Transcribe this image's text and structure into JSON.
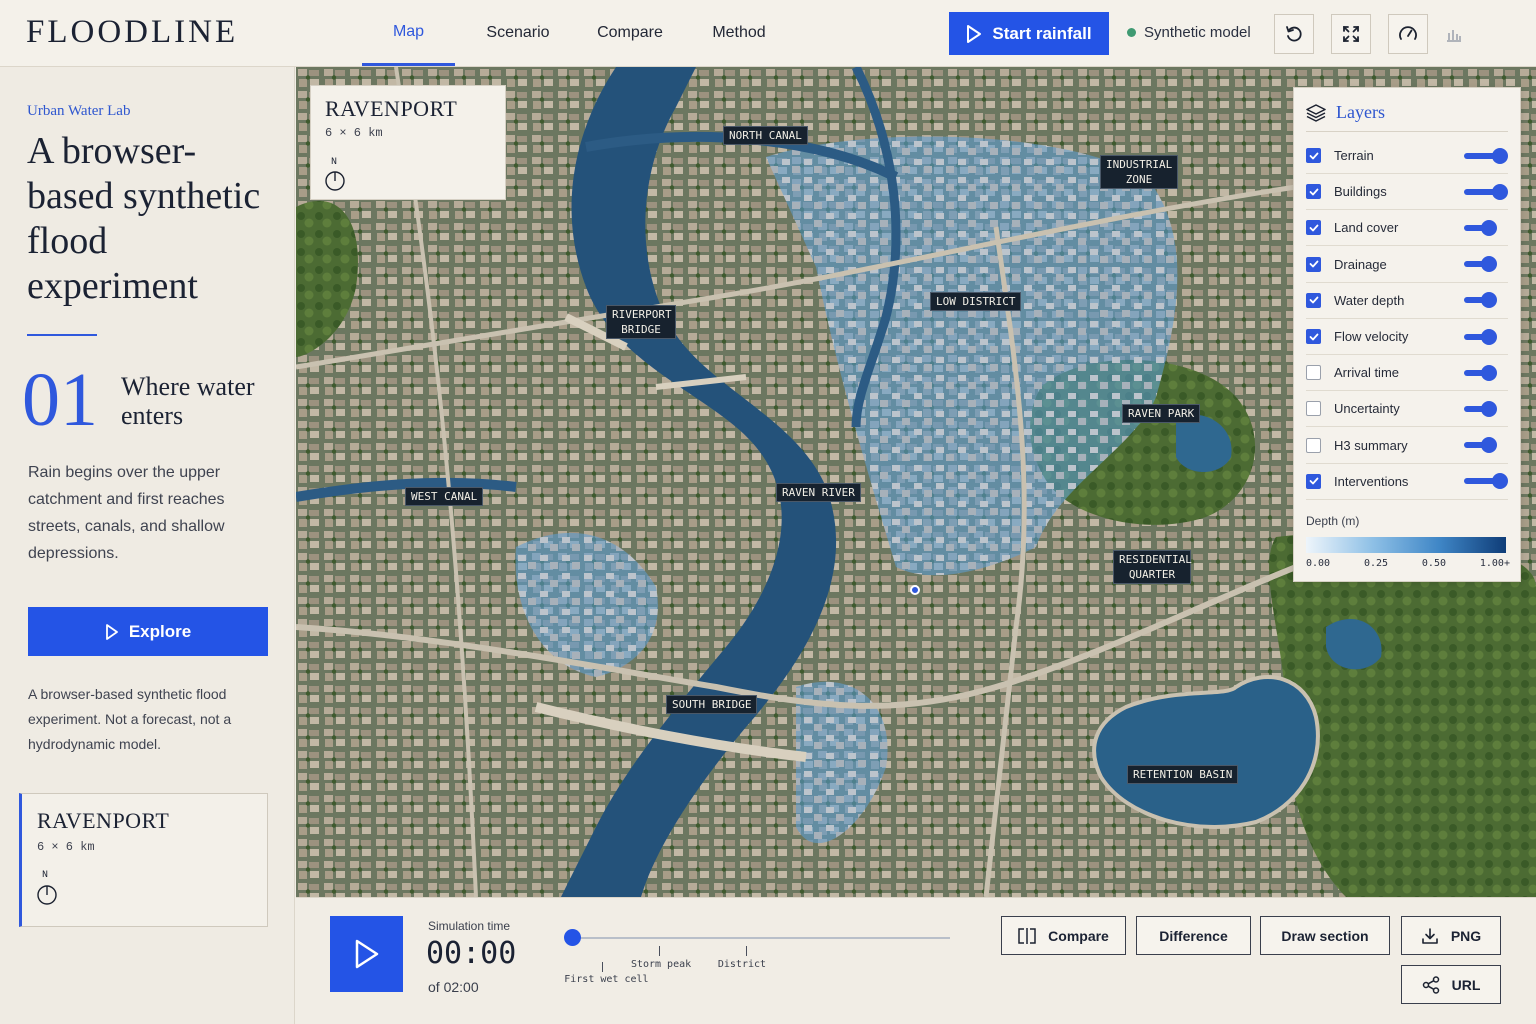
{
  "app": {
    "title": "FLOODLINE"
  },
  "nav": {
    "tabs": [
      {
        "label": "Map",
        "active": true
      },
      {
        "label": "Scenario",
        "active": false
      },
      {
        "label": "Compare",
        "active": false
      },
      {
        "label": "Method",
        "active": false
      }
    ]
  },
  "header": {
    "start_label": "Start rainfall",
    "status_text": "Synthetic model",
    "status_color": "#3f9a72",
    "icons": [
      "reset-icon",
      "fullscreen-icon",
      "gauge-icon",
      "bar-chart-icon"
    ]
  },
  "sidebar": {
    "kicker": "Urban Water Lab",
    "title": "A browser-based synthetic flood experiment",
    "step_number": "01",
    "step_title": "Where water enters",
    "step_body": "Rain begins over the upper catchment and first reaches streets, canals, and shallow depressions.",
    "explore_label": "Explore",
    "disclaimer": "A browser-based synthetic flood experiment. Not a forecast, not a hydrodynamic model.",
    "card": {
      "title": "RAVENPORT",
      "size": "6 × 6 km",
      "north": "N"
    }
  },
  "map": {
    "card": {
      "title": "RAVENPORT",
      "size": "6 × 6 km",
      "north": "N"
    },
    "labels": {
      "north_canal": "NORTH CANAL",
      "industrial_zone": "INDUSTRIAL ZONE",
      "low_district": "LOW DISTRICT",
      "riverport_bridge": "RIVERPORT BRIDGE",
      "raven_park": "RAVEN PARK",
      "west_canal": "WEST CANAL",
      "raven_river": "RAVEN RIVER",
      "residential_quarter": "RESIDENTIAL QUARTER",
      "south_bridge": "SOUTH BRIDGE",
      "retention_basin": "RETENTION BASIN"
    }
  },
  "layers": {
    "title": "Layers",
    "items": [
      {
        "label": "Terrain",
        "checked": true,
        "opacity": 1.0
      },
      {
        "label": "Buildings",
        "checked": true,
        "opacity": 1.0
      },
      {
        "label": "Land cover",
        "checked": true,
        "opacity": 0.6
      },
      {
        "label": "Drainage",
        "checked": true,
        "opacity": 0.6
      },
      {
        "label": "Water depth",
        "checked": true,
        "opacity": 0.6
      },
      {
        "label": "Flow velocity",
        "checked": true,
        "opacity": 0.6
      },
      {
        "label": "Arrival time",
        "checked": false,
        "opacity": 0.6
      },
      {
        "label": "Uncertainty",
        "checked": false,
        "opacity": 0.6
      },
      {
        "label": "H3 summary",
        "checked": false,
        "opacity": 0.6
      },
      {
        "label": "Interventions",
        "checked": true,
        "opacity": 1.0
      }
    ],
    "legend": {
      "title": "Depth (m)",
      "ticks": [
        "0.00",
        "0.25",
        "0.50",
        "1.00+"
      ]
    }
  },
  "playback": {
    "label": "Simulation time",
    "time": "00:00",
    "total": "of 02:00",
    "progress": 0,
    "markers": [
      {
        "label": "First wet cell",
        "at": 0.08
      },
      {
        "label": "Storm peak",
        "at": 0.23
      },
      {
        "label": "District",
        "at": 0.46
      }
    ]
  },
  "tools": {
    "compare": "Compare",
    "difference": "Difference",
    "draw_section": "Draw section",
    "png": "PNG",
    "url": "URL"
  }
}
